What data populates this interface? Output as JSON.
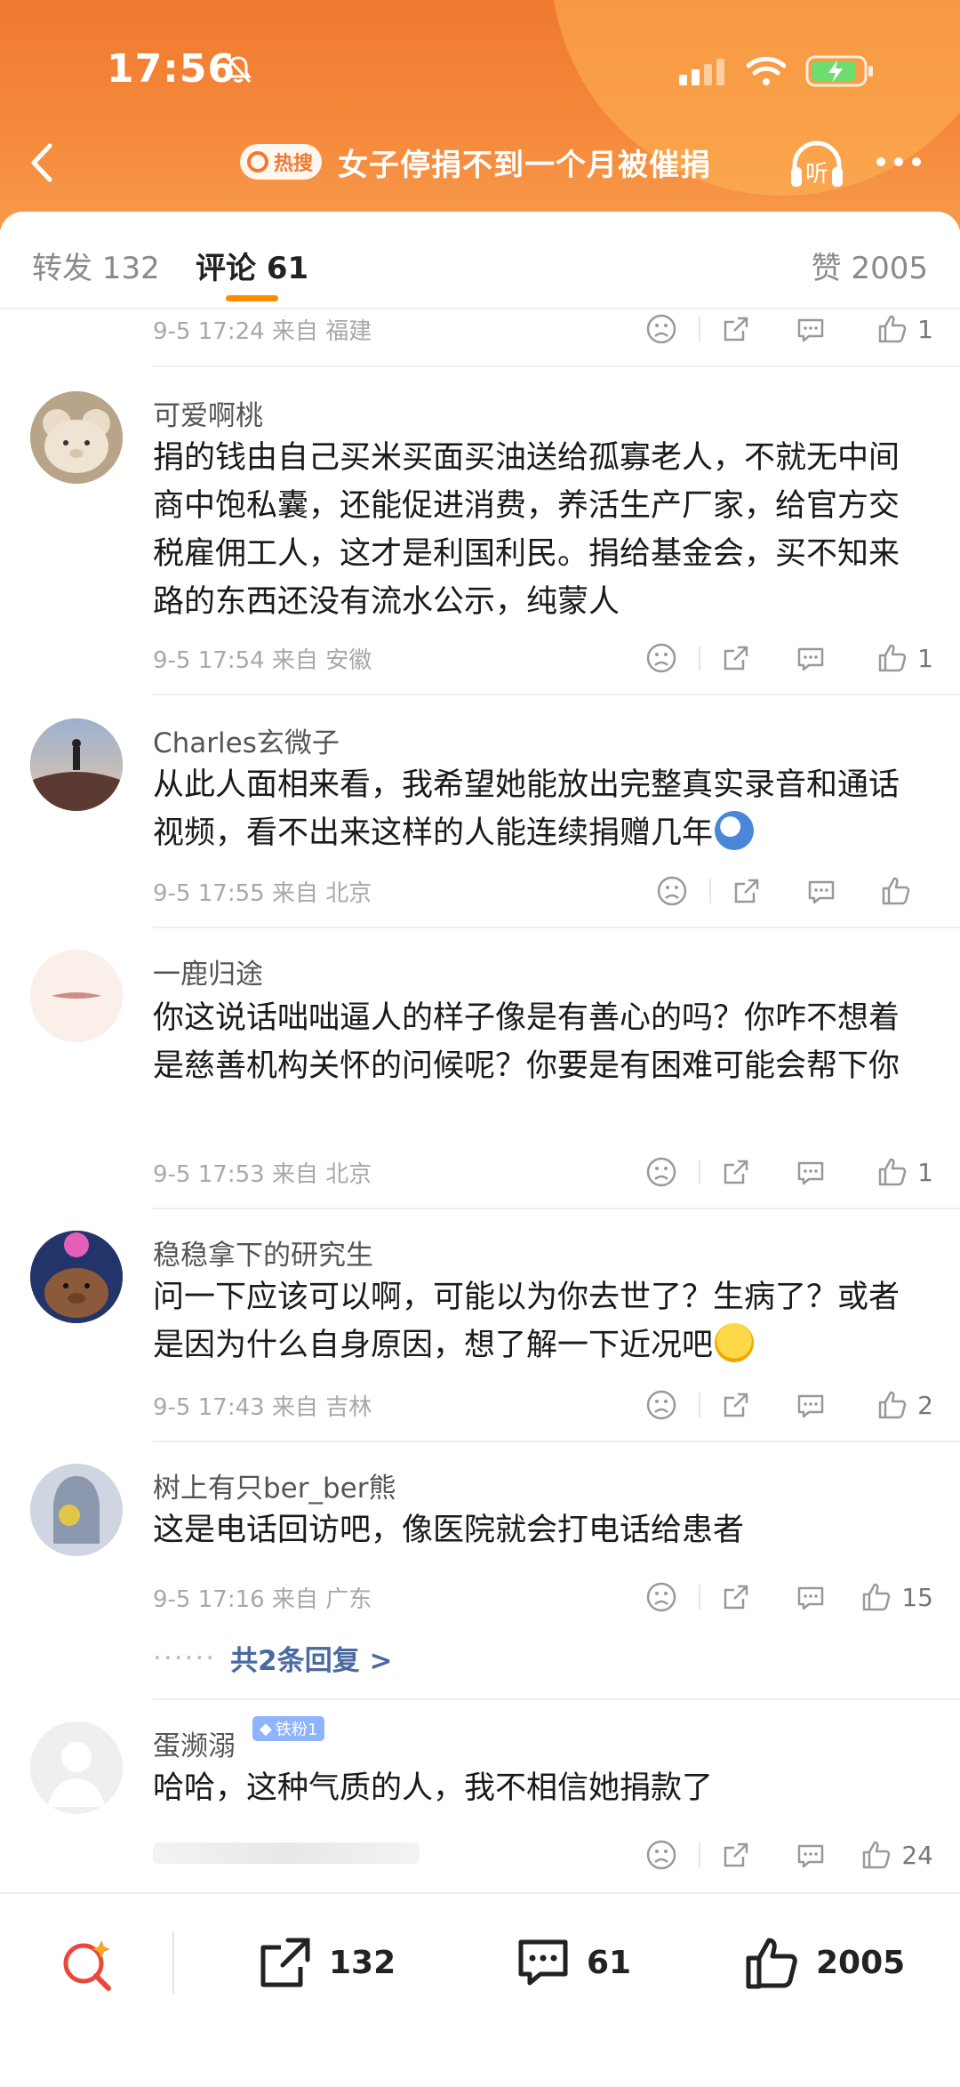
{
  "status_bar": {
    "time": "17:56"
  },
  "nav": {
    "hot_label": "热搜",
    "title": "女子停捐不到一个月被催捐"
  },
  "tabs": {
    "repost": "转发 132",
    "comments": "评论 61",
    "likes": "赞 2005"
  },
  "partial_comment": {
    "meta": "9-5 17:24 来自 福建",
    "likes": "1"
  },
  "comments": [
    {
      "name": "可爱啊桃",
      "text": "捐的钱由自己买米买面买油送给孤寡老人，不就无中间商中饱私囊，还能促进消费，养活生产厂家，给官方交税雇佣工人，这才是利国利民。捐给基金会，买不知来路的东西还没有流水公示，纯蒙人",
      "meta": "9-5 17:54 来自 安徽",
      "likes": "1"
    },
    {
      "name": "Charles玄微子",
      "text": "从此人面相来看，我希望她能放出完整真实录音和通话视频，看不出来这样的人能连续捐赠几年",
      "meta": "9-5 17:55 来自 北京",
      "likes": ""
    },
    {
      "name": "一鹿归途",
      "text": "你这说话咄咄逼人的样子像是有善心的吗？你咋不想着是慈善机构关怀的问候呢？你要是有困难可能会帮下你",
      "meta": "9-5 17:53 来自 北京",
      "likes": "1"
    },
    {
      "name": "稳稳拿下的研究生",
      "text": "问一下应该可以啊，可能以为你去世了？生病了？或者是因为什么自身原因，想了解一下近况吧",
      "meta": "9-5 17:43 来自 吉林",
      "likes": "2"
    },
    {
      "name": "树上有只ber_ber熊",
      "text": "这是电话回访吧，像医院就会打电话给患者",
      "meta": "9-5 17:16 来自 广东",
      "likes": "15",
      "replies": "共2条回复 >"
    },
    {
      "name": "蛋濒溺",
      "badge": "铁粉1",
      "text": "哈哈，这种气质的人，我不相信她捐款了",
      "likes": "24"
    }
  ],
  "bottom_bar": {
    "repost_count": "132",
    "comment_count": "61",
    "like_count": "2005"
  },
  "colors": {
    "accent": "#ff8a00",
    "header": "#f07a2f",
    "link": "#4b6aa0"
  }
}
